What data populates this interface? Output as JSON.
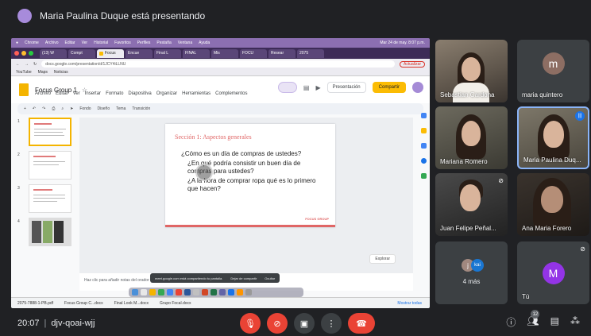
{
  "banner": {
    "text": "Maria Paulina Duque está presentando"
  },
  "shared_screen": {
    "mac_menu": [
      "Chrome",
      "Archivo",
      "Editar",
      "Ver",
      "Historial",
      "Favoritos",
      "Perfiles",
      "Pestaña",
      "Ventana",
      "Ayuda"
    ],
    "mac_clock": "Mar 24 de may. 8:07 p.m.",
    "tabs": [
      "(13) W",
      "Compt",
      "Focus",
      "Encue",
      "Final L",
      "FINAL",
      "Mis",
      "FOCU",
      "Resear",
      "2075"
    ],
    "url": "docs.google.com/presentation/d/1JCY4iLLNU",
    "update_label": "Actualizar",
    "bookmarks": [
      "YouTube",
      "Maps",
      "Noticias"
    ],
    "doc_title": "Focus Group 1",
    "menu": [
      "Archivo",
      "Editar",
      "Ver",
      "Insertar",
      "Formato",
      "Diapositiva",
      "Organizar",
      "Herramientas",
      "Complementos"
    ],
    "presentation_label": "Presentación",
    "share_label": "Compartir",
    "toolbar": [
      "Fondo",
      "Diseño",
      "Tema",
      "Transición"
    ],
    "thumb_numbers": [
      "1",
      "2",
      "3",
      "4"
    ],
    "slide": {
      "title": "Sección 1: Aspectos generales",
      "bullets": [
        "¿Cómo es un día de compras de ustedes?",
        "¿En qué podría consistir un buen día de compras para ustedes?",
        "¿A la hora de comprar ropa qué es lo primero que hacen?"
      ],
      "logo": "FOCUS GROUP"
    },
    "notes_placeholder": "Haz clic para añadir notas del orador",
    "explore_label": "Explorar",
    "share_notice": "meet.google.com está compartiendo tu pantalla.",
    "stop_sharing": "Dejar de compartir",
    "hide": "Ocultar",
    "downloads": [
      "2075-7888-1-PB.pdf",
      "Focus Group C...docx",
      "Final Look M...docx",
      "Grupo Focal.docx"
    ],
    "show_all": "Mostrar todas"
  },
  "participants": [
    {
      "name": "Sebastian Cardona",
      "type": "video"
    },
    {
      "name": "maria quintero",
      "type": "avatar",
      "initial": "m",
      "color": "#8d6e63"
    },
    {
      "name": "Mariana Romero",
      "type": "video"
    },
    {
      "name": "Maria Paulina Duq...",
      "type": "video",
      "speaking": true
    },
    {
      "name": "Juan Felipe Peñal...",
      "type": "video",
      "muted": true
    },
    {
      "name": "Ana Maria Forero",
      "type": "video"
    },
    {
      "name": "4 más",
      "type": "more",
      "initials": [
        "j",
        "kai"
      ]
    },
    {
      "name": "Tú",
      "type": "avatar",
      "initial": "M",
      "color": "#9334e6",
      "muted": true
    }
  ],
  "bottom": {
    "time": "20:07",
    "meeting_code": "djv-qoai-wjj",
    "people_count": "12"
  }
}
